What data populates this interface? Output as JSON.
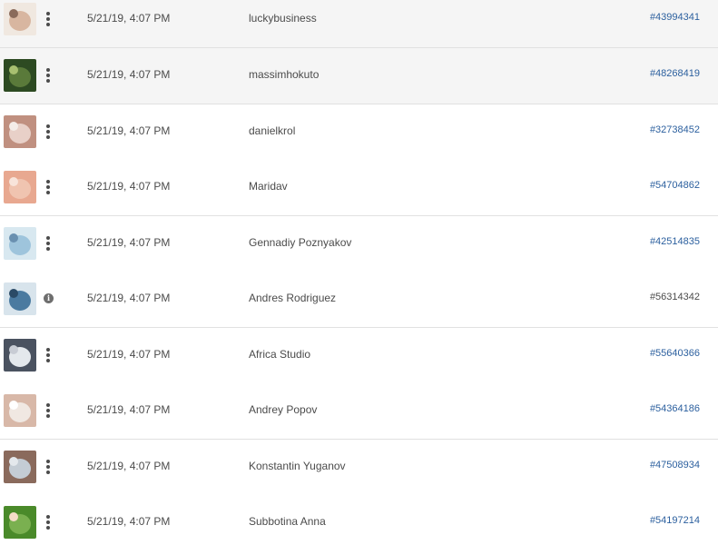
{
  "rows": [
    {
      "date": "5/21/19, 4:07 PM",
      "author": "luckybusiness",
      "asset_id": "#43994341",
      "action_icon": "more-vertical-icon",
      "thumb_colors": [
        "#d8b6a0",
        "#f0e8e0",
        "#8a6a5a"
      ]
    },
    {
      "date": "5/21/19, 4:07 PM",
      "author": "massimhokuto",
      "asset_id": "#48268419",
      "action_icon": "more-vertical-icon",
      "thumb_colors": [
        "#5a7a3a",
        "#2d4a22",
        "#a8c070"
      ]
    },
    {
      "date": "5/21/19, 4:07 PM",
      "author": "danielkrol",
      "asset_id": "#32738452",
      "action_icon": "more-vertical-icon",
      "thumb_colors": [
        "#e8d0c8",
        "#c09080",
        "#f4ece8"
      ]
    },
    {
      "date": "5/21/19, 4:07 PM",
      "author": "Maridav",
      "asset_id": "#54704862",
      "action_icon": "more-vertical-icon",
      "thumb_colors": [
        "#f0c4b0",
        "#e8a890",
        "#f8e4da"
      ]
    },
    {
      "date": "5/21/19, 4:07 PM",
      "author": "Gennadiy Poznyakov",
      "asset_id": "#42514835",
      "action_icon": "more-vertical-icon",
      "thumb_colors": [
        "#9ec4dc",
        "#d8e8f0",
        "#6a90b0"
      ]
    },
    {
      "date": "5/21/19, 4:07 PM",
      "author": "Andres Rodriguez",
      "asset_id": "#56314342",
      "action_icon": "info-icon",
      "action_label": "i",
      "thumb_colors": [
        "#4a7aa0",
        "#d8e4ec",
        "#2a4a66"
      ]
    },
    {
      "date": "5/21/19, 4:07 PM",
      "author": "Africa Studio",
      "asset_id": "#55640366",
      "action_icon": "more-vertical-icon",
      "thumb_colors": [
        "#e4e8ec",
        "#4a5260",
        "#c8ccd4"
      ]
    },
    {
      "date": "5/21/19, 4:07 PM",
      "author": "Andrey Popov",
      "asset_id": "#54364186",
      "action_icon": "more-vertical-icon",
      "thumb_colors": [
        "#f0e8e2",
        "#d8b8a8",
        "#ffffff"
      ]
    },
    {
      "date": "5/21/19, 4:07 PM",
      "author": "Konstantin Yuganov",
      "asset_id": "#47508934",
      "action_icon": "more-vertical-icon",
      "thumb_colors": [
        "#c4ccd4",
        "#8a6a5c",
        "#e4e8ec"
      ]
    },
    {
      "date": "5/21/19, 4:07 PM",
      "author": "Subbotina Anna",
      "asset_id": "#54197214",
      "action_icon": "more-vertical-icon",
      "thumb_colors": [
        "#7ab050",
        "#4a8a2a",
        "#f4dcc8"
      ]
    }
  ],
  "colors": {
    "link": "#2b5f9e",
    "text": "#4b4b4b",
    "divider": "#e1e1e1",
    "hover_row": "#f5f5f5"
  }
}
